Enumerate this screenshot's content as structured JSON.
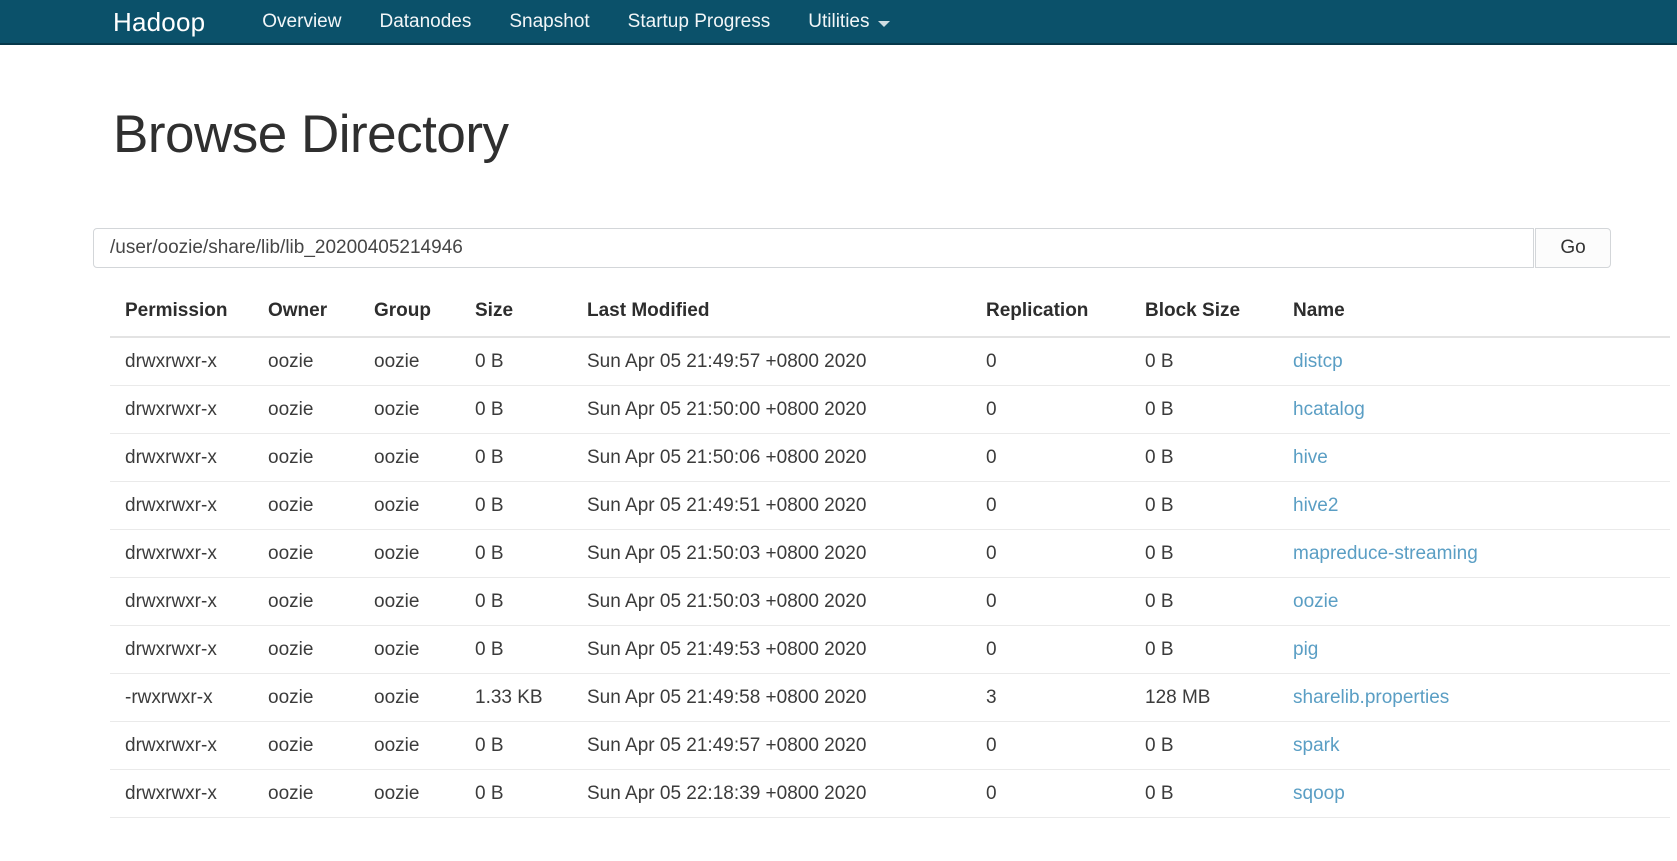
{
  "navbar": {
    "brand": "Hadoop",
    "items": [
      {
        "label": "Overview",
        "dropdown": false
      },
      {
        "label": "Datanodes",
        "dropdown": false
      },
      {
        "label": "Snapshot",
        "dropdown": false
      },
      {
        "label": "Startup Progress",
        "dropdown": false
      },
      {
        "label": "Utilities",
        "dropdown": true
      }
    ],
    "background_color": "#0b516a"
  },
  "page": {
    "title": "Browse Directory"
  },
  "path_bar": {
    "value": "/user/oozie/share/lib/lib_20200405214946",
    "placeholder": "Enter a path",
    "go_label": "Go"
  },
  "table": {
    "columns": [
      "Permission",
      "Owner",
      "Group",
      "Size",
      "Last Modified",
      "Replication",
      "Block Size",
      "Name"
    ],
    "rows": [
      {
        "permission": "drwxrwxr-x",
        "owner": "oozie",
        "group": "oozie",
        "size": "0 B",
        "last_modified": "Sun Apr 05 21:49:57 +0800 2020",
        "replication": "0",
        "block_size": "0 B",
        "name": "distcp"
      },
      {
        "permission": "drwxrwxr-x",
        "owner": "oozie",
        "group": "oozie",
        "size": "0 B",
        "last_modified": "Sun Apr 05 21:50:00 +0800 2020",
        "replication": "0",
        "block_size": "0 B",
        "name": "hcatalog"
      },
      {
        "permission": "drwxrwxr-x",
        "owner": "oozie",
        "group": "oozie",
        "size": "0 B",
        "last_modified": "Sun Apr 05 21:50:06 +0800 2020",
        "replication": "0",
        "block_size": "0 B",
        "name": "hive"
      },
      {
        "permission": "drwxrwxr-x",
        "owner": "oozie",
        "group": "oozie",
        "size": "0 B",
        "last_modified": "Sun Apr 05 21:49:51 +0800 2020",
        "replication": "0",
        "block_size": "0 B",
        "name": "hive2"
      },
      {
        "permission": "drwxrwxr-x",
        "owner": "oozie",
        "group": "oozie",
        "size": "0 B",
        "last_modified": "Sun Apr 05 21:50:03 +0800 2020",
        "replication": "0",
        "block_size": "0 B",
        "name": "mapreduce-streaming"
      },
      {
        "permission": "drwxrwxr-x",
        "owner": "oozie",
        "group": "oozie",
        "size": "0 B",
        "last_modified": "Sun Apr 05 21:50:03 +0800 2020",
        "replication": "0",
        "block_size": "0 B",
        "name": "oozie"
      },
      {
        "permission": "drwxrwxr-x",
        "owner": "oozie",
        "group": "oozie",
        "size": "0 B",
        "last_modified": "Sun Apr 05 21:49:53 +0800 2020",
        "replication": "0",
        "block_size": "0 B",
        "name": "pig"
      },
      {
        "permission": "-rwxrwxr-x",
        "owner": "oozie",
        "group": "oozie",
        "size": "1.33 KB",
        "last_modified": "Sun Apr 05 21:49:58 +0800 2020",
        "replication": "3",
        "block_size": "128 MB",
        "name": "sharelib.properties"
      },
      {
        "permission": "drwxrwxr-x",
        "owner": "oozie",
        "group": "oozie",
        "size": "0 B",
        "last_modified": "Sun Apr 05 21:49:57 +0800 2020",
        "replication": "0",
        "block_size": "0 B",
        "name": "spark"
      },
      {
        "permission": "drwxrwxr-x",
        "owner": "oozie",
        "group": "oozie",
        "size": "0 B",
        "last_modified": "Sun Apr 05 22:18:39 +0800 2020",
        "replication": "0",
        "block_size": "0 B",
        "name": "sqoop"
      }
    ],
    "link_color": "#5a9ec4"
  }
}
